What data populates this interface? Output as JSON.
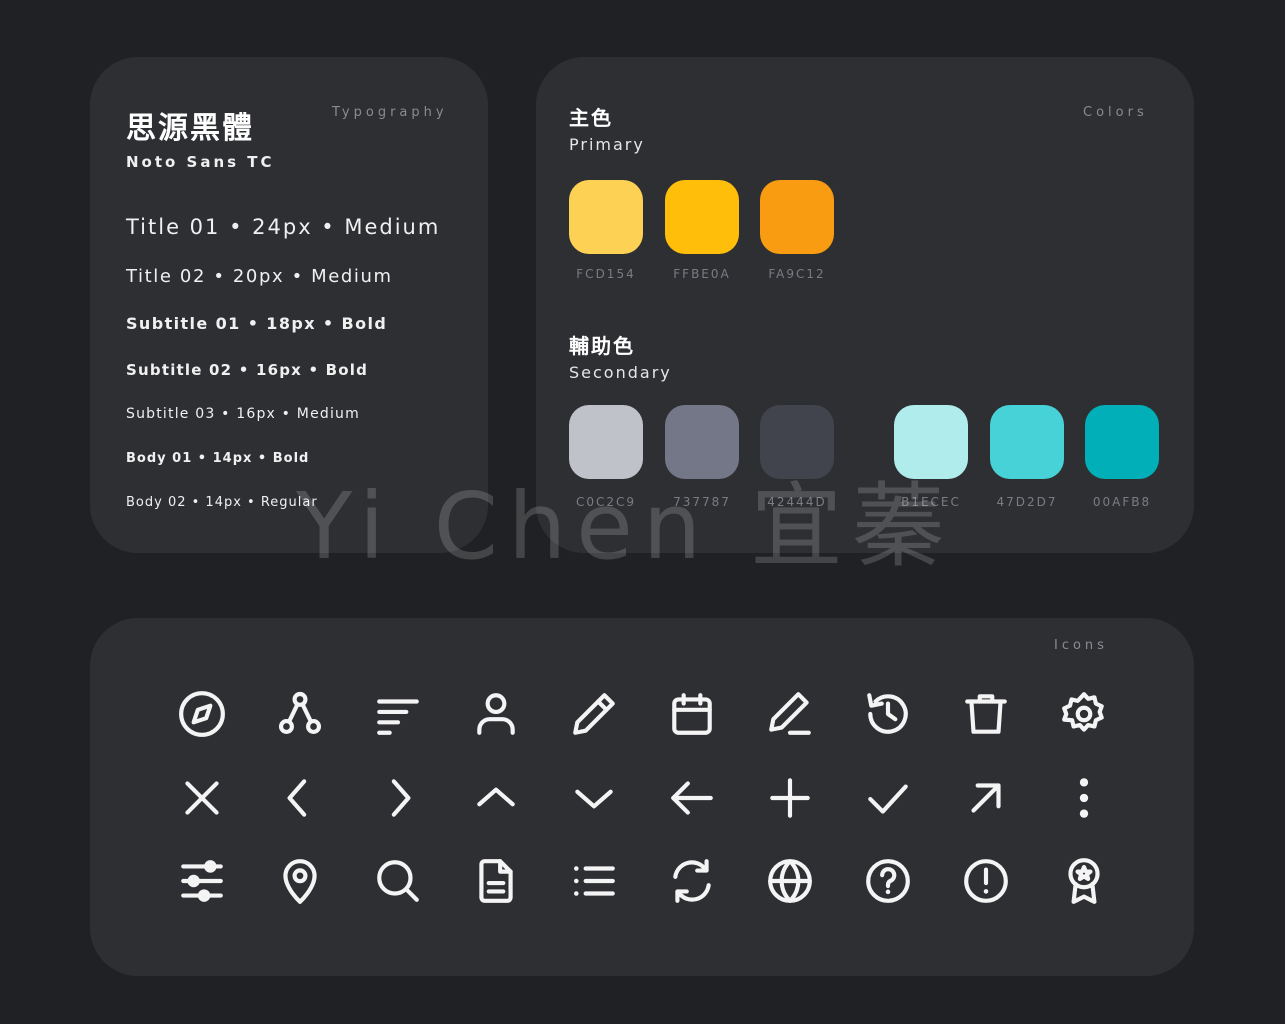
{
  "typography": {
    "section_label": "Typography",
    "font_name": "思源黑體",
    "font_latin": "Noto Sans TC",
    "styles": [
      "Title 01 • 24px • Medium",
      "Title 02 • 20px • Medium",
      "Subtitle 01 • 18px • Bold",
      "Subtitle 02 • 16px • Bold",
      "Subtitle 03 • 16px • Medium",
      "Body 01 • 14px • Bold",
      "Body 02 • 14px • Regular"
    ]
  },
  "colors": {
    "section_label": "Colors",
    "primary": {
      "title": "主色",
      "subtitle": "Primary",
      "swatches": [
        {
          "hex": "FCD154",
          "color": "#FCD154"
        },
        {
          "hex": "FFBE0A",
          "color": "#FFBE0A"
        },
        {
          "hex": "FA9C12",
          "color": "#FA9C12"
        }
      ]
    },
    "secondary": {
      "title": "輔助色",
      "subtitle": "Secondary",
      "swatches": [
        {
          "hex": "C0C2C9",
          "color": "#C0C2C9"
        },
        {
          "hex": "737787",
          "color": "#737787"
        },
        {
          "hex": "42444D",
          "color": "#42444D"
        },
        {
          "hex": "B1ECEC",
          "color": "#B1ECEC"
        },
        {
          "hex": "47D2D7",
          "color": "#47D2D7"
        },
        {
          "hex": "00AFB8",
          "color": "#00AFB8"
        }
      ]
    }
  },
  "icons": {
    "section_label": "Icons",
    "rows": [
      [
        "compass-icon",
        "share-nodes-icon",
        "align-left-icon",
        "user-icon",
        "pencil-icon",
        "calendar-icon",
        "edit-icon",
        "history-icon",
        "trash-icon",
        "gear-icon"
      ],
      [
        "close-icon",
        "chevron-left-icon",
        "chevron-right-icon",
        "chevron-up-icon",
        "chevron-down-icon",
        "arrow-left-icon",
        "plus-icon",
        "check-icon",
        "arrow-up-right-icon",
        "more-vertical-icon"
      ],
      [
        "sliders-icon",
        "map-pin-icon",
        "search-icon",
        "document-icon",
        "list-icon",
        "refresh-icon",
        "globe-icon",
        "help-circle-icon",
        "alert-circle-icon",
        "award-icon"
      ]
    ]
  },
  "watermark": "Yi Chen 宜蓁"
}
